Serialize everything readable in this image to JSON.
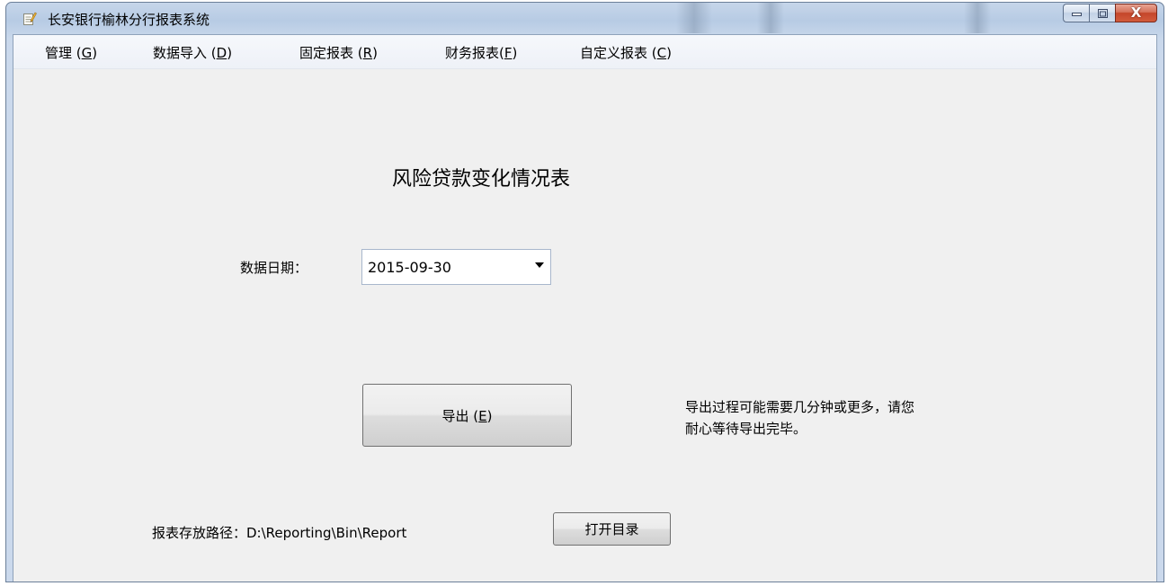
{
  "window": {
    "title": "长安银行榆林分行报表系统",
    "controls": {
      "close_glyph": "X"
    }
  },
  "menu": {
    "items": [
      {
        "label": "管理 (",
        "accel": "G",
        "suffix": ")"
      },
      {
        "label": "数据导入 (",
        "accel": "D",
        "suffix": ")"
      },
      {
        "label": "固定报表 (",
        "accel": "R",
        "suffix": ")"
      },
      {
        "label": "财务报表(",
        "accel": "F",
        "suffix": ")"
      },
      {
        "label": "自定义报表 (",
        "accel": "C",
        "suffix": ")"
      }
    ]
  },
  "form": {
    "report_title": "风险贷款变化情况表",
    "date_label": "数据日期：",
    "date_value": "2015-09-30",
    "export_button": {
      "label": "导出 (",
      "accel": "E",
      "suffix": ")"
    },
    "export_note_line1": "导出过程可能需要几分钟或更多，请您",
    "export_note_line2": "耐心等待导出完毕。",
    "path_label": "报表存放路径：D:\\Reporting\\Bin\\Report",
    "open_dir_button": "打开目录"
  },
  "icons": {
    "app": "report-app-icon",
    "dropdown": "dropdown-arrow-icon"
  },
  "colors": {
    "client_bg": "#f0f0f0",
    "close_red": "#c4462a"
  }
}
